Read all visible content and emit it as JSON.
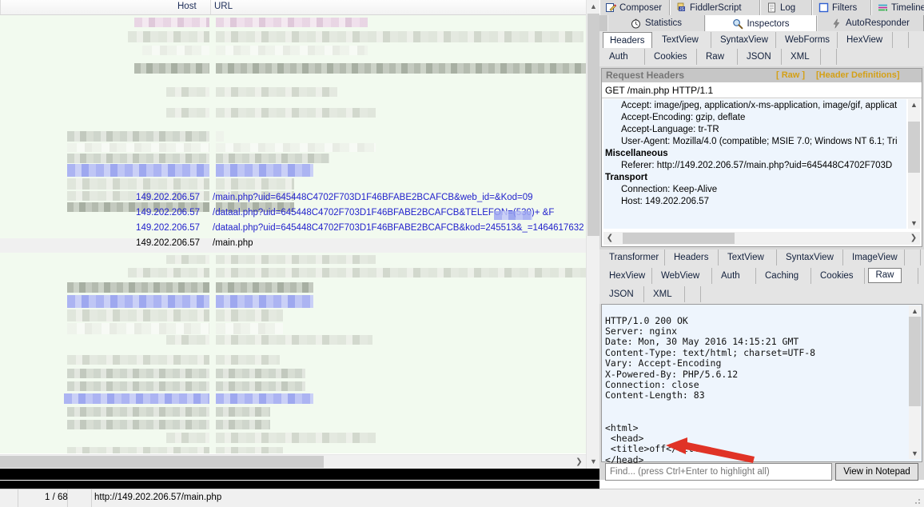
{
  "app": "Fiddler Web Debugger",
  "sessions": {
    "columns": [
      "Host",
      "URL"
    ],
    "host_label": "Host",
    "url_label": "URL",
    "visible_rows": [
      {
        "host": "149.202.206.57",
        "url": "/main.php?uid=645448C4702F703D1F46BFABE2BCAFCB&web_id=&Kod=09",
        "state": "link"
      },
      {
        "host": "149.202.206.57",
        "url": "/dataal.php?uid=645448C4702F703D1F46BFABE2BCAFCB&TELEFON=(530)+           &F",
        "state": "link"
      },
      {
        "host": "149.202.206.57",
        "url": "/dataal.php?uid=645448C4702F703D1F46BFABE2BCAFCB&kod=245513&_=1464617632",
        "state": "link"
      },
      {
        "host": "149.202.206.57",
        "url": "/main.php",
        "state": "selected"
      }
    ]
  },
  "top_tabs": [
    {
      "label": "Composer",
      "icon": "composer-icon"
    },
    {
      "label": "FiddlerScript",
      "icon": "script-icon"
    },
    {
      "label": "Log",
      "icon": "log-icon"
    },
    {
      "label": "Filters",
      "icon": "filters-icon"
    },
    {
      "label": "Timeline",
      "icon": "timeline-icon"
    }
  ],
  "main_tabs": [
    {
      "label": "Statistics",
      "icon": "stopwatch-icon",
      "active": false
    },
    {
      "label": "Inspectors",
      "icon": "magnifier-icon",
      "active": true
    },
    {
      "label": "AutoResponder",
      "icon": "lightning-icon",
      "active": false
    }
  ],
  "request": {
    "tabs_row1": [
      "Headers",
      "TextView",
      "SyntaxView",
      "WebForms",
      "HexView"
    ],
    "tabs_row2": [
      "Auth",
      "Cookies",
      "Raw",
      "JSON",
      "XML"
    ],
    "active_tab": "Headers",
    "panel_title": "Request Headers",
    "raw_link": "[ Raw ]",
    "defs_link": "[Header Definitions]",
    "request_line": "GET /main.php HTTP/1.1",
    "header_groups": [
      {
        "name": "",
        "items": [
          "Accept: image/jpeg, application/x-ms-application, image/gif, applicat",
          "Accept-Encoding: gzip, deflate",
          "Accept-Language: tr-TR",
          "User-Agent: Mozilla/4.0 (compatible; MSIE 7.0; Windows NT 6.1; Tri"
        ]
      },
      {
        "name": "Miscellaneous",
        "items": [
          "Referer: http://149.202.206.57/main.php?uid=645448C4702F703D"
        ]
      },
      {
        "name": "Transport",
        "items": [
          "Connection: Keep-Alive",
          "Host: 149.202.206.57"
        ]
      }
    ]
  },
  "response": {
    "tabs_row1": [
      "Transformer",
      "Headers",
      "TextView",
      "SyntaxView",
      "ImageView"
    ],
    "tabs_row2": [
      "HexView",
      "WebView",
      "Auth",
      "Caching",
      "Cookies",
      "Raw"
    ],
    "tabs_row3": [
      "JSON",
      "XML"
    ],
    "active_tab": "Raw",
    "raw_text": "HTTP/1.0 200 OK\nServer: nginx\nDate: Mon, 30 May 2016 14:15:21 GMT\nContent-Type: text/html; charset=UTF-8\nVary: Accept-Encoding\nX-Powered-By: PHP/5.6.12\nConnection: close\nContent-Length: 83\n\n\n<html>\n <head>\n <title>off</title>\n</head>\n<body>"
  },
  "find": {
    "placeholder": "Find... (press Ctrl+Enter to highlight all)",
    "value": "",
    "notepad_button": "View in Notepad"
  },
  "status_bar": {
    "session_counter": "1 / 68",
    "url": "http://149.202.206.57/main.php"
  },
  "colors": {
    "link": "#2222cc",
    "gold": "#d4a017",
    "arrow_red": "#e03326",
    "list_bg": "#f2faef",
    "raw_bg": "#eef5fd"
  }
}
